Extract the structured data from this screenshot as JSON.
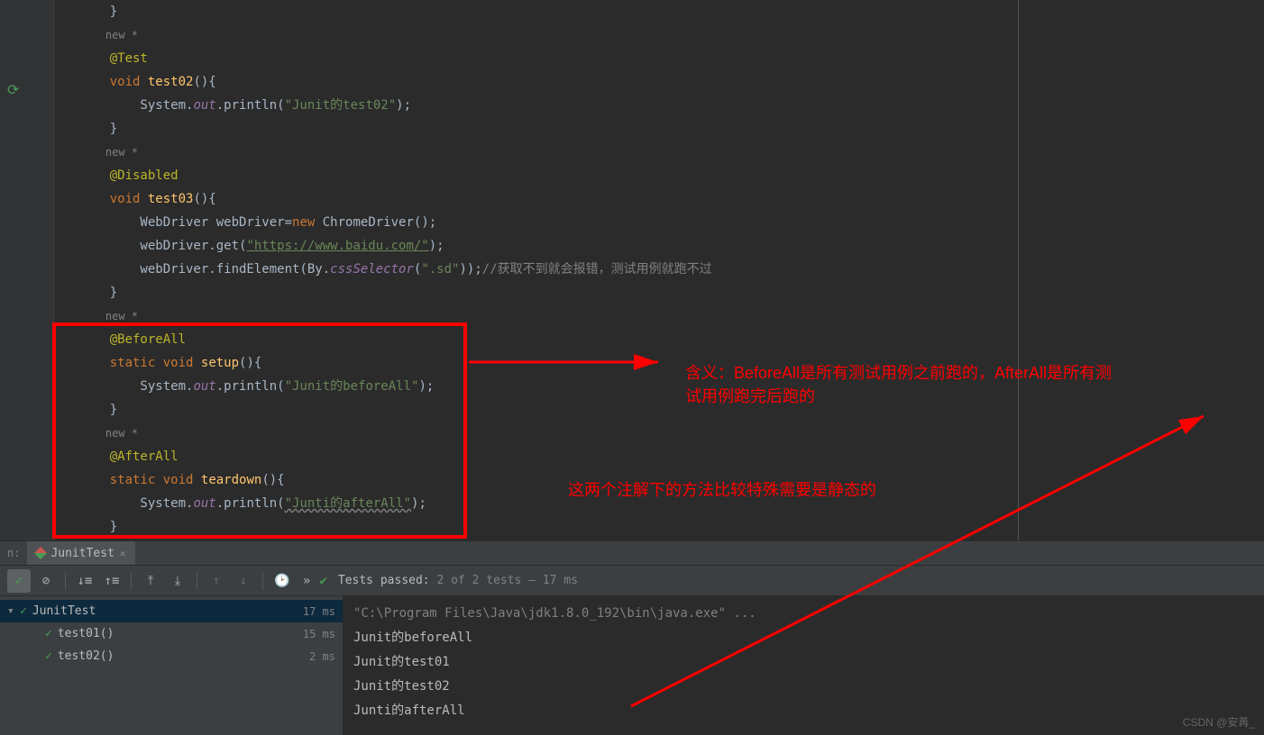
{
  "code": {
    "l1": "    }",
    "l2_hint": "new *",
    "l3_anno": "@Test",
    "l4_kw1": "void",
    "l4_name": "test02",
    "l4_tail": "(){",
    "l5_a": "        System.",
    "l5_field": "out",
    "l5_b": ".println(",
    "l5_str": "\"Junit的test02\"",
    "l5_c": ");",
    "l6": "    }",
    "l7_hint": "new *",
    "l8_anno": "@Disabled",
    "l9_kw1": "void",
    "l9_name": "test03",
    "l9_tail": "(){",
    "l10_a": "        WebDriver webDriver=",
    "l10_new": "new",
    "l10_class": " ChromeDriver",
    "l10_b": "();",
    "l11_a": "        webDriver.get(",
    "l11_str": "\"https://www.baidu.com/\"",
    "l11_b": ");",
    "l12_a": "        webDriver.findElement(By.",
    "l12_m": "cssSelector",
    "l12_b": "(",
    "l12_str": "\".sd\"",
    "l12_c": "));",
    "l12_comment": "//获取不到就会报错，测试用例就跑不过",
    "l13": "    }",
    "l14_hint": "new *",
    "l15_anno": "@BeforeAll",
    "l16_kw1": "static",
    "l16_kw2": "void",
    "l16_name": "setup",
    "l16_tail": "(){",
    "l17_a": "        System.",
    "l17_field": "out",
    "l17_b": ".println(",
    "l17_str": "\"Junit的beforeAll\"",
    "l17_c": ");",
    "l18": "    }",
    "l19_hint": "new *",
    "l20_anno": "@AfterAll",
    "l21_kw1": "static",
    "l21_kw2": "void",
    "l21_name": "teardown",
    "l21_tail": "(){",
    "l22_a": "        System.",
    "l22_field": "out",
    "l22_b": ".println(",
    "l22_str": "\"Junti的afterAll\"",
    "l22_c": ");",
    "l23": "    }"
  },
  "annotations": {
    "text1": "含义：BeforeAll是所有测试用例之前跑的，AfterAll是所有测",
    "text1b": "试用例跑完后跑的",
    "text2": "这两个注解下的方法比较特殊需要是静态的"
  },
  "tab": {
    "prefix": "n:",
    "name": "JunitTest"
  },
  "toolbar": {
    "status_prefix": "Tests passed: ",
    "status_count": "2",
    "status_mid": " of 2 tests",
    "status_time": " – 17 ms"
  },
  "tree": {
    "root": "JunitTest",
    "root_time": "17 ms",
    "t1": "test01()",
    "t1_time": "15 ms",
    "t2": "test02()",
    "t2_time": "2 ms"
  },
  "console": {
    "l1": "\"C:\\Program Files\\Java\\jdk1.8.0_192\\bin\\java.exe\" ...",
    "l2": "Junit的beforeAll",
    "l3": "Junit的test01",
    "l4": "Junit的test02",
    "l5": "Junti的afterAll"
  },
  "watermark": "CSDN @安苒_"
}
